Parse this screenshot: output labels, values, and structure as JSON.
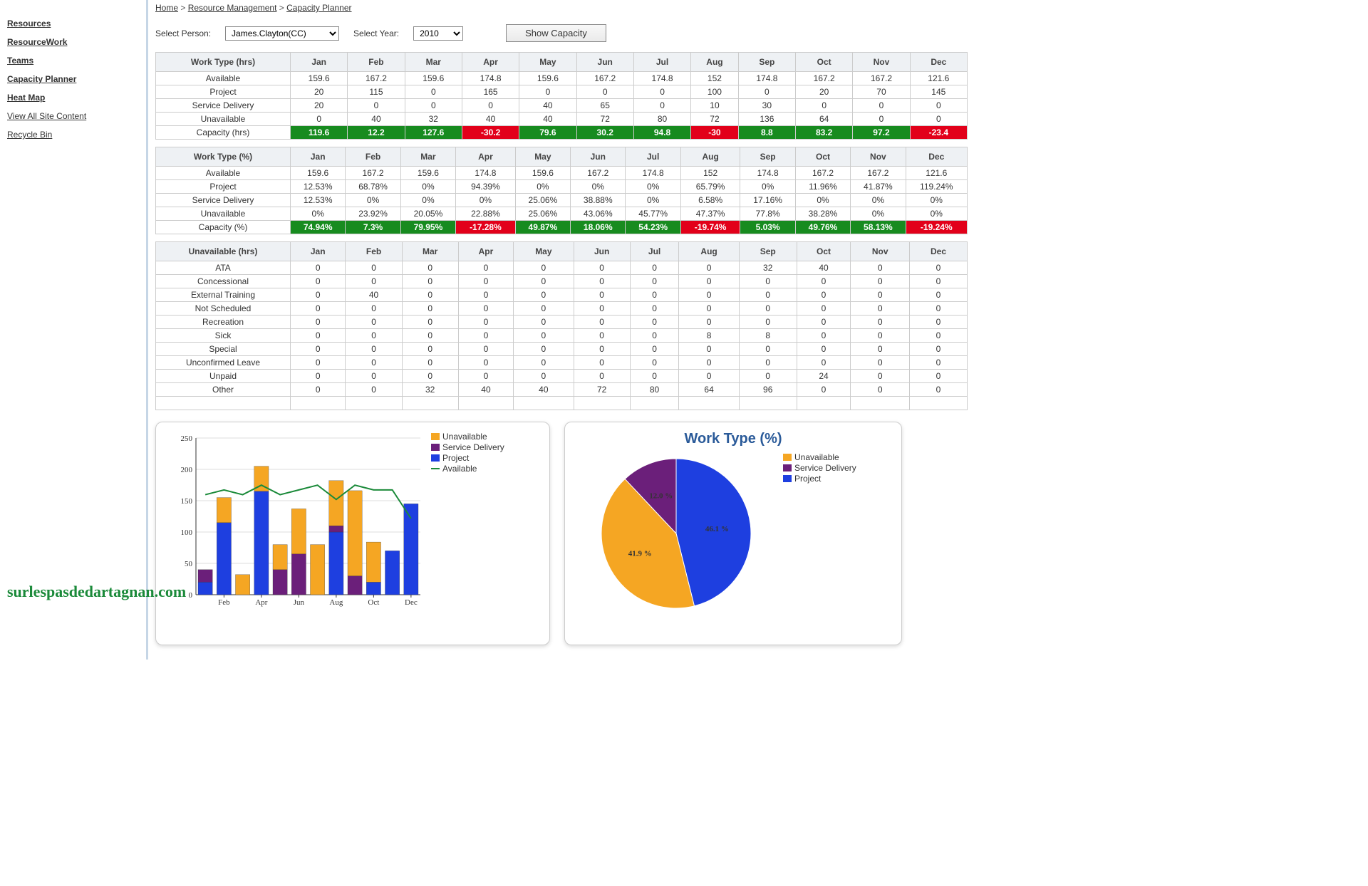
{
  "breadcrumb": [
    {
      "label": "Home",
      "href": "#"
    },
    {
      "label": "Resource Management",
      "href": "#"
    },
    {
      "label": "Capacity Planner",
      "href": "#"
    }
  ],
  "sidebar": [
    {
      "label": "Resources",
      "bold": true
    },
    {
      "label": "ResourceWork",
      "bold": true
    },
    {
      "label": "Teams",
      "bold": true
    },
    {
      "label": "Capacity Planner",
      "bold": true
    },
    {
      "label": "Heat Map",
      "bold": true
    },
    {
      "label": "View All Site Content",
      "bold": false
    },
    {
      "label": "Recycle Bin",
      "bold": false
    }
  ],
  "filters": {
    "person_label": "Select Person:",
    "person_value": "James.Clayton(CC)",
    "year_label": "Select Year:",
    "year_value": "2010",
    "show_button": "Show Capacity"
  },
  "months": [
    "Jan",
    "Feb",
    "Mar",
    "Apr",
    "May",
    "Jun",
    "Jul",
    "Aug",
    "Sep",
    "Oct",
    "Nov",
    "Dec"
  ],
  "table_hrs": {
    "header": "Work Type (hrs)",
    "rows": [
      {
        "label": "Available",
        "v": [
          159.6,
          167.2,
          159.6,
          174.8,
          159.6,
          167.2,
          174.8,
          152,
          174.8,
          167.2,
          167.2,
          121.6
        ]
      },
      {
        "label": "Project",
        "v": [
          20,
          115,
          0,
          165,
          0,
          0,
          0,
          100,
          0,
          20,
          70,
          145
        ]
      },
      {
        "label": "Service Delivery",
        "v": [
          20,
          0,
          0,
          0,
          40,
          65,
          0,
          10,
          30,
          0,
          0,
          0
        ]
      },
      {
        "label": "Unavailable",
        "v": [
          0,
          40,
          32,
          40,
          40,
          72,
          80,
          72,
          136,
          64,
          0,
          0
        ]
      },
      {
        "label": "Capacity (hrs)",
        "v": [
          119.6,
          12.2,
          127.6,
          -30.2,
          79.6,
          30.2,
          94.8,
          -30,
          8.8,
          83.2,
          97.2,
          -23.4
        ],
        "capacity": true
      }
    ]
  },
  "table_pct": {
    "header": "Work Type (%)",
    "rows": [
      {
        "label": "Available",
        "v": [
          "159.6",
          "167.2",
          "159.6",
          "174.8",
          "159.6",
          "167.2",
          "174.8",
          "152",
          "174.8",
          "167.2",
          "167.2",
          "121.6"
        ]
      },
      {
        "label": "Project",
        "v": [
          "12.53%",
          "68.78%",
          "0%",
          "94.39%",
          "0%",
          "0%",
          "0%",
          "65.79%",
          "0%",
          "11.96%",
          "41.87%",
          "119.24%"
        ]
      },
      {
        "label": "Service Delivery",
        "v": [
          "12.53%",
          "0%",
          "0%",
          "0%",
          "25.06%",
          "38.88%",
          "0%",
          "6.58%",
          "17.16%",
          "0%",
          "0%",
          "0%"
        ]
      },
      {
        "label": "Unavailable",
        "v": [
          "0%",
          "23.92%",
          "20.05%",
          "22.88%",
          "25.06%",
          "43.06%",
          "45.77%",
          "47.37%",
          "77.8%",
          "38.28%",
          "0%",
          "0%"
        ]
      },
      {
        "label": "Capacity (%)",
        "v": [
          "74.94%",
          "7.3%",
          "79.95%",
          "-17.28%",
          "49.87%",
          "18.06%",
          "54.23%",
          "-19.74%",
          "5.03%",
          "49.76%",
          "58.13%",
          "-19.24%"
        ],
        "capacity": true
      }
    ]
  },
  "table_unavail": {
    "header": "Unavailable (hrs)",
    "rows": [
      {
        "label": "ATA",
        "v": [
          0,
          0,
          0,
          0,
          0,
          0,
          0,
          0,
          32,
          40,
          0,
          0
        ]
      },
      {
        "label": "Concessional",
        "v": [
          0,
          0,
          0,
          0,
          0,
          0,
          0,
          0,
          0,
          0,
          0,
          0
        ]
      },
      {
        "label": "External Training",
        "v": [
          0,
          40,
          0,
          0,
          0,
          0,
          0,
          0,
          0,
          0,
          0,
          0
        ]
      },
      {
        "label": "Not Scheduled",
        "v": [
          0,
          0,
          0,
          0,
          0,
          0,
          0,
          0,
          0,
          0,
          0,
          0
        ]
      },
      {
        "label": "Recreation",
        "v": [
          0,
          0,
          0,
          0,
          0,
          0,
          0,
          0,
          0,
          0,
          0,
          0
        ]
      },
      {
        "label": "Sick",
        "v": [
          0,
          0,
          0,
          0,
          0,
          0,
          0,
          8,
          8,
          0,
          0,
          0
        ]
      },
      {
        "label": "Special",
        "v": [
          0,
          0,
          0,
          0,
          0,
          0,
          0,
          0,
          0,
          0,
          0,
          0
        ]
      },
      {
        "label": "Unconfirmed Leave",
        "v": [
          0,
          0,
          0,
          0,
          0,
          0,
          0,
          0,
          0,
          0,
          0,
          0
        ]
      },
      {
        "label": "Unpaid",
        "v": [
          0,
          0,
          0,
          0,
          0,
          0,
          0,
          0,
          0,
          24,
          0,
          0
        ]
      },
      {
        "label": "Other",
        "v": [
          0,
          0,
          32,
          40,
          40,
          72,
          80,
          64,
          96,
          0,
          0,
          0
        ]
      }
    ]
  },
  "legend": {
    "unavailable": "Unavailable",
    "service_delivery": "Service Delivery",
    "project": "Project",
    "available": "Available"
  },
  "colors": {
    "unavailable": "#f5a623",
    "service_delivery": "#6b1f7a",
    "project": "#1e3fe0",
    "available": "#1b8a3a"
  },
  "chart_data": [
    {
      "type": "bar",
      "title": "",
      "xlabel": "",
      "ylabel": "",
      "ylim": [
        0,
        250
      ],
      "y_ticks": [
        0,
        50,
        100,
        150,
        200,
        250
      ],
      "x_tick_labels": [
        "Feb",
        "Apr",
        "Jun",
        "Aug",
        "Oct",
        "Dec"
      ],
      "categories": [
        "Jan",
        "Feb",
        "Mar",
        "Apr",
        "May",
        "Jun",
        "Jul",
        "Aug",
        "Sep",
        "Oct",
        "Nov",
        "Dec"
      ],
      "series": [
        {
          "name": "Project",
          "color": "#1e3fe0",
          "values": [
            20,
            115,
            0,
            165,
            0,
            0,
            0,
            100,
            0,
            20,
            70,
            145
          ]
        },
        {
          "name": "Service Delivery",
          "color": "#6b1f7a",
          "values": [
            20,
            0,
            0,
            0,
            40,
            65,
            0,
            10,
            30,
            0,
            0,
            0
          ]
        },
        {
          "name": "Unavailable",
          "color": "#f5a623",
          "values": [
            0,
            40,
            32,
            40,
            40,
            72,
            80,
            72,
            136,
            64,
            0,
            0
          ]
        }
      ],
      "line_series": {
        "name": "Available",
        "color": "#1b8a3a",
        "values": [
          159.6,
          167.2,
          159.6,
          174.8,
          159.6,
          167.2,
          174.8,
          152,
          174.8,
          167.2,
          167.2,
          121.6
        ]
      }
    },
    {
      "type": "pie",
      "title": "Work Type (%)",
      "slices": [
        {
          "name": "Project",
          "color": "#1e3fe0",
          "value": 46.1,
          "label": "46.1 %"
        },
        {
          "name": "Unavailable",
          "color": "#f5a623",
          "value": 41.9,
          "label": "41.9 %"
        },
        {
          "name": "Service Delivery",
          "color": "#6b1f7a",
          "value": 12.0,
          "label": "12.0 %"
        }
      ],
      "legend": [
        "Unavailable",
        "Service Delivery",
        "Project"
      ]
    }
  ],
  "watermark": "surlespasdedartagnan.com"
}
